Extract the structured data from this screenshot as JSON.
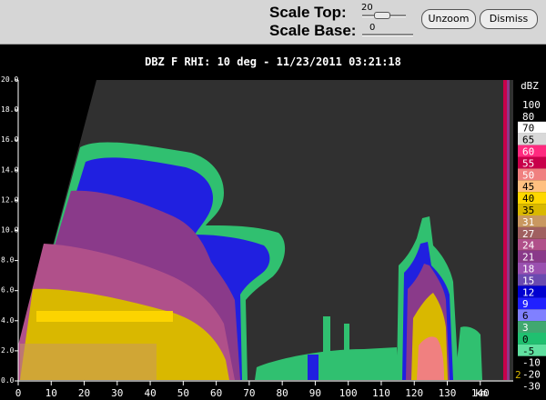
{
  "controls": {
    "scale_top_label": "Scale Top:",
    "scale_top_value": "20",
    "scale_top_level": 0.35,
    "scale_base_label": "Scale Base:",
    "scale_base_value": "0",
    "scale_base_level": 0.0,
    "unzoom_label": "Unzoom",
    "dismiss_label": "Dismiss"
  },
  "plot": {
    "title": "DBZ F  RHI: 10 deg  -  11/23/2011 03:21:18",
    "x_unit": "km",
    "x_ticks": [
      "0",
      "10",
      "20",
      "30",
      "40",
      "50",
      "60",
      "70",
      "80",
      "90",
      "100",
      "110",
      "120",
      "130",
      "140"
    ],
    "y_ticks": [
      "0.0",
      "2.0",
      "4.0",
      "6.0",
      "8.0",
      "10.0",
      "12.0",
      "14.0",
      "16.0",
      "18.0",
      "20.0"
    ]
  },
  "colorbar": {
    "unit": "dBZ",
    "levels": [
      {
        "label": "100",
        "color": "#000000"
      },
      {
        "label": "80",
        "color": "#000000"
      },
      {
        "label": "70",
        "color": "#ffffff"
      },
      {
        "label": "65",
        "color": "#d8d8d8"
      },
      {
        "label": "60",
        "color": "#ff2a7f"
      },
      {
        "label": "55",
        "color": "#c8004a"
      },
      {
        "label": "50",
        "color": "#f08080"
      },
      {
        "label": "45",
        "color": "#ffc080"
      },
      {
        "label": "40",
        "color": "#ffd700"
      },
      {
        "label": "35",
        "color": "#d9b800"
      },
      {
        "label": "31",
        "color": "#c99860"
      },
      {
        "label": "27",
        "color": "#a06060"
      },
      {
        "label": "24",
        "color": "#b0508a"
      },
      {
        "label": "21",
        "color": "#8a3a8a"
      },
      {
        "label": "18",
        "color": "#9a50b0"
      },
      {
        "label": "15",
        "color": "#6a4ab0"
      },
      {
        "label": "12",
        "color": "#0000d0"
      },
      {
        "label": "9",
        "color": "#2020ff"
      },
      {
        "label": "6",
        "color": "#8080ff"
      },
      {
        "label": "3",
        "color": "#40a870"
      },
      {
        "label": "0",
        "color": "#20c070"
      },
      {
        "label": "-5",
        "color": "#60e0a0"
      },
      {
        "label": "-10",
        "color": "#000000"
      },
      {
        "label": "-20",
        "color": "#000000"
      },
      {
        "label": "-30",
        "color": "#000000"
      }
    ]
  }
}
